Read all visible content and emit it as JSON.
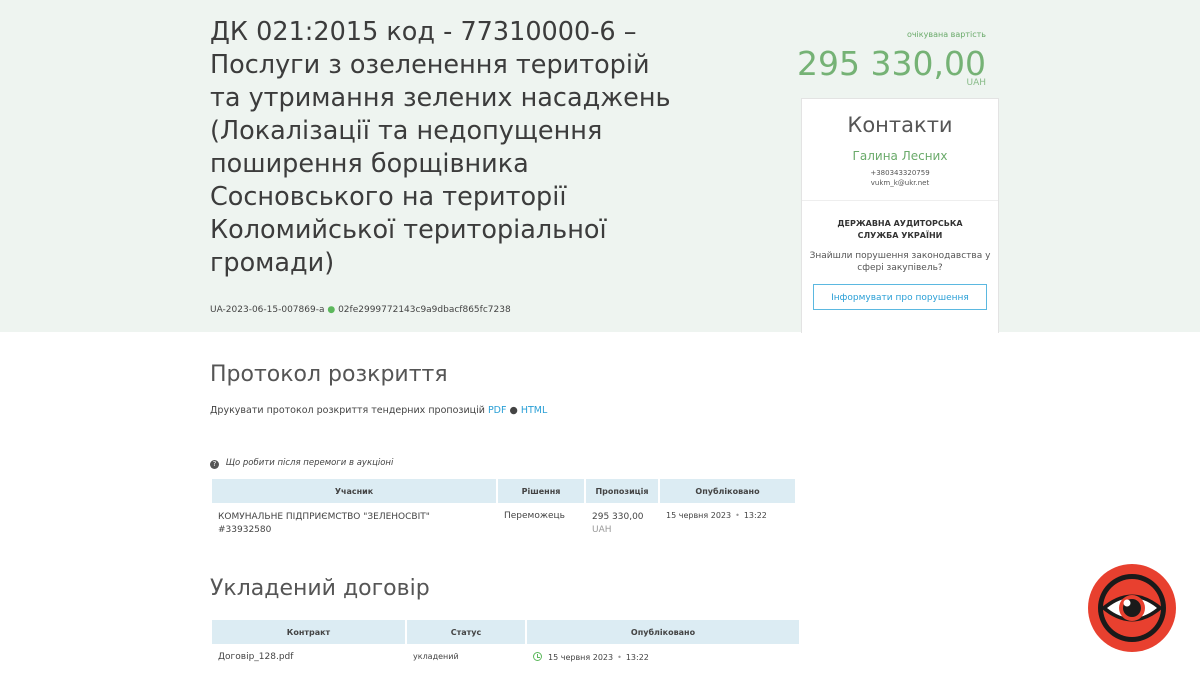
{
  "tender": {
    "title": "ДК 021:2015 код - 77310000-6 – Послуги з озеленення територій та утримання зелених насаджень (Локалізації та недопущення поширення борщівника Сосновського на території Коломийської територіальної громади)",
    "id": "UA-2023-06-15-007869-a",
    "hash": "02fe2999772143c9a9dbacf865fc7238"
  },
  "price": {
    "label": "очікувана вартість",
    "value": "295 330,00",
    "currency": "UAH"
  },
  "contacts": {
    "title": "Контакти",
    "name": "Галина Лесних",
    "phone": "+380343320759",
    "email": "vukm_k@ukr.net"
  },
  "audit": {
    "title": "ДЕРЖАВНА АУДИТОРСЬКА СЛУЖБА УКРАЇНИ",
    "text": "Знайшли порушення законодавства у сфері закупівель?",
    "button_label": "Інформувати про порушення"
  },
  "protocol": {
    "title": "Протокол розкриття",
    "print_text": "Друкувати протокол розкриття тендерних пропозицій",
    "pdf_label": "PDF",
    "html_label": "HTML",
    "help_text": "Що робити після перемоги в аукціоні",
    "headers": [
      "Учасник",
      "Рішення",
      "Пропозиція",
      "Опубліковано"
    ],
    "rows": [
      {
        "participant": "КОМУНАЛЬНЕ ПІДПРИЄМСТВО \"ЗЕЛЕНОСВІТ\"",
        "code": "#33932580",
        "decision": "Переможець",
        "amount": "295 330,00",
        "currency": "UAH",
        "date": "15 червня 2023",
        "time": "13:22"
      }
    ]
  },
  "contract": {
    "title": "Укладений договір",
    "headers": [
      "Контракт",
      "Статус",
      "Опубліковано"
    ],
    "rows": [
      {
        "file": "Договір_128.pdf",
        "status": "укладений",
        "date": "15 червня 2023",
        "time": "13:22"
      }
    ]
  },
  "colors": {
    "hero_background": "#eef4f0",
    "accent_green": "#75b275",
    "link_blue": "#2a9fd6",
    "table_header": "#dcecf3",
    "logo_red": "#e8402f"
  },
  "icons": {
    "help": "question-circle-icon",
    "clock": "clock-icon",
    "logo": "eye-logo-icon"
  }
}
